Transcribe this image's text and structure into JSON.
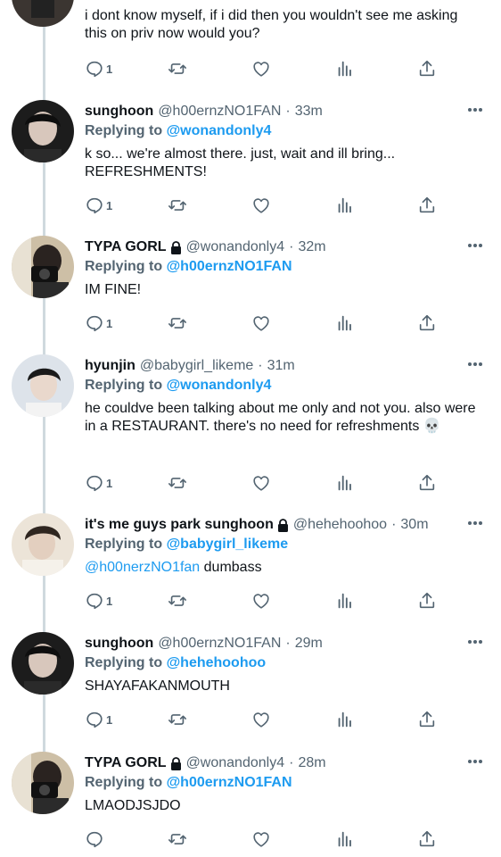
{
  "top_tweet": {
    "text": "i dont know myself, if i did then you wouldn't see me asking this on priv now would you?",
    "reply_count": "1"
  },
  "tweets": [
    {
      "name": "sunghoon",
      "locked": false,
      "handle": "@h00ernzNO1FAN",
      "time": "33m",
      "replying_label": "Replying to",
      "replying_to": "@wonandonly4",
      "mention": "",
      "text": "k so... we're almost there. just, wait and ill bring... REFRESHMENTS!",
      "reply_count": "1"
    },
    {
      "name": "TYPA GORL",
      "locked": true,
      "handle": "@wonandonly4",
      "time": "32m",
      "replying_label": "Replying to",
      "replying_to": "@h00ernzNO1FAN",
      "mention": "",
      "text": "IM FINE!",
      "reply_count": "1"
    },
    {
      "name": "hyunjin",
      "locked": false,
      "handle": "@babygirl_likeme",
      "time": "31m",
      "replying_label": "Replying to",
      "replying_to": "@wonandonly4",
      "mention": "",
      "text": "he couldve been talking about me only and not you. also were in a RESTAURANT. there's no need for refreshments 💀",
      "reply_count": "1"
    },
    {
      "name": "it's me guys park sunghoon",
      "locked": true,
      "handle": "@hehehoohoo",
      "time": "30m",
      "replying_label": "Replying to",
      "replying_to": "@babygirl_likeme",
      "mention": "@h00nerzNO1fan",
      "text": " dumbass",
      "reply_count": "1"
    },
    {
      "name": "sunghoon",
      "locked": false,
      "handle": "@h00ernzNO1FAN",
      "time": "29m",
      "replying_label": "Replying to",
      "replying_to": "@hehehoohoo",
      "mention": "",
      "text": "SHAYAFAKANMOUTH",
      "reply_count": "1"
    },
    {
      "name": "TYPA GORL",
      "locked": true,
      "handle": "@wonandonly4",
      "time": "28m",
      "replying_label": "Replying to",
      "replying_to": "@h00ernzNO1FAN",
      "mention": "",
      "text": "LMAODJSJDO",
      "reply_count": ""
    }
  ],
  "icons": {
    "reply": "reply-icon",
    "retweet": "retweet-icon",
    "like": "heart-icon",
    "analytics": "analytics-icon",
    "share": "share-icon",
    "more": "more-icon",
    "lock": "lock-icon"
  },
  "colors": {
    "link": "#1d9bf0",
    "secondary_text": "#536471",
    "thread_line": "#cfd9de"
  }
}
